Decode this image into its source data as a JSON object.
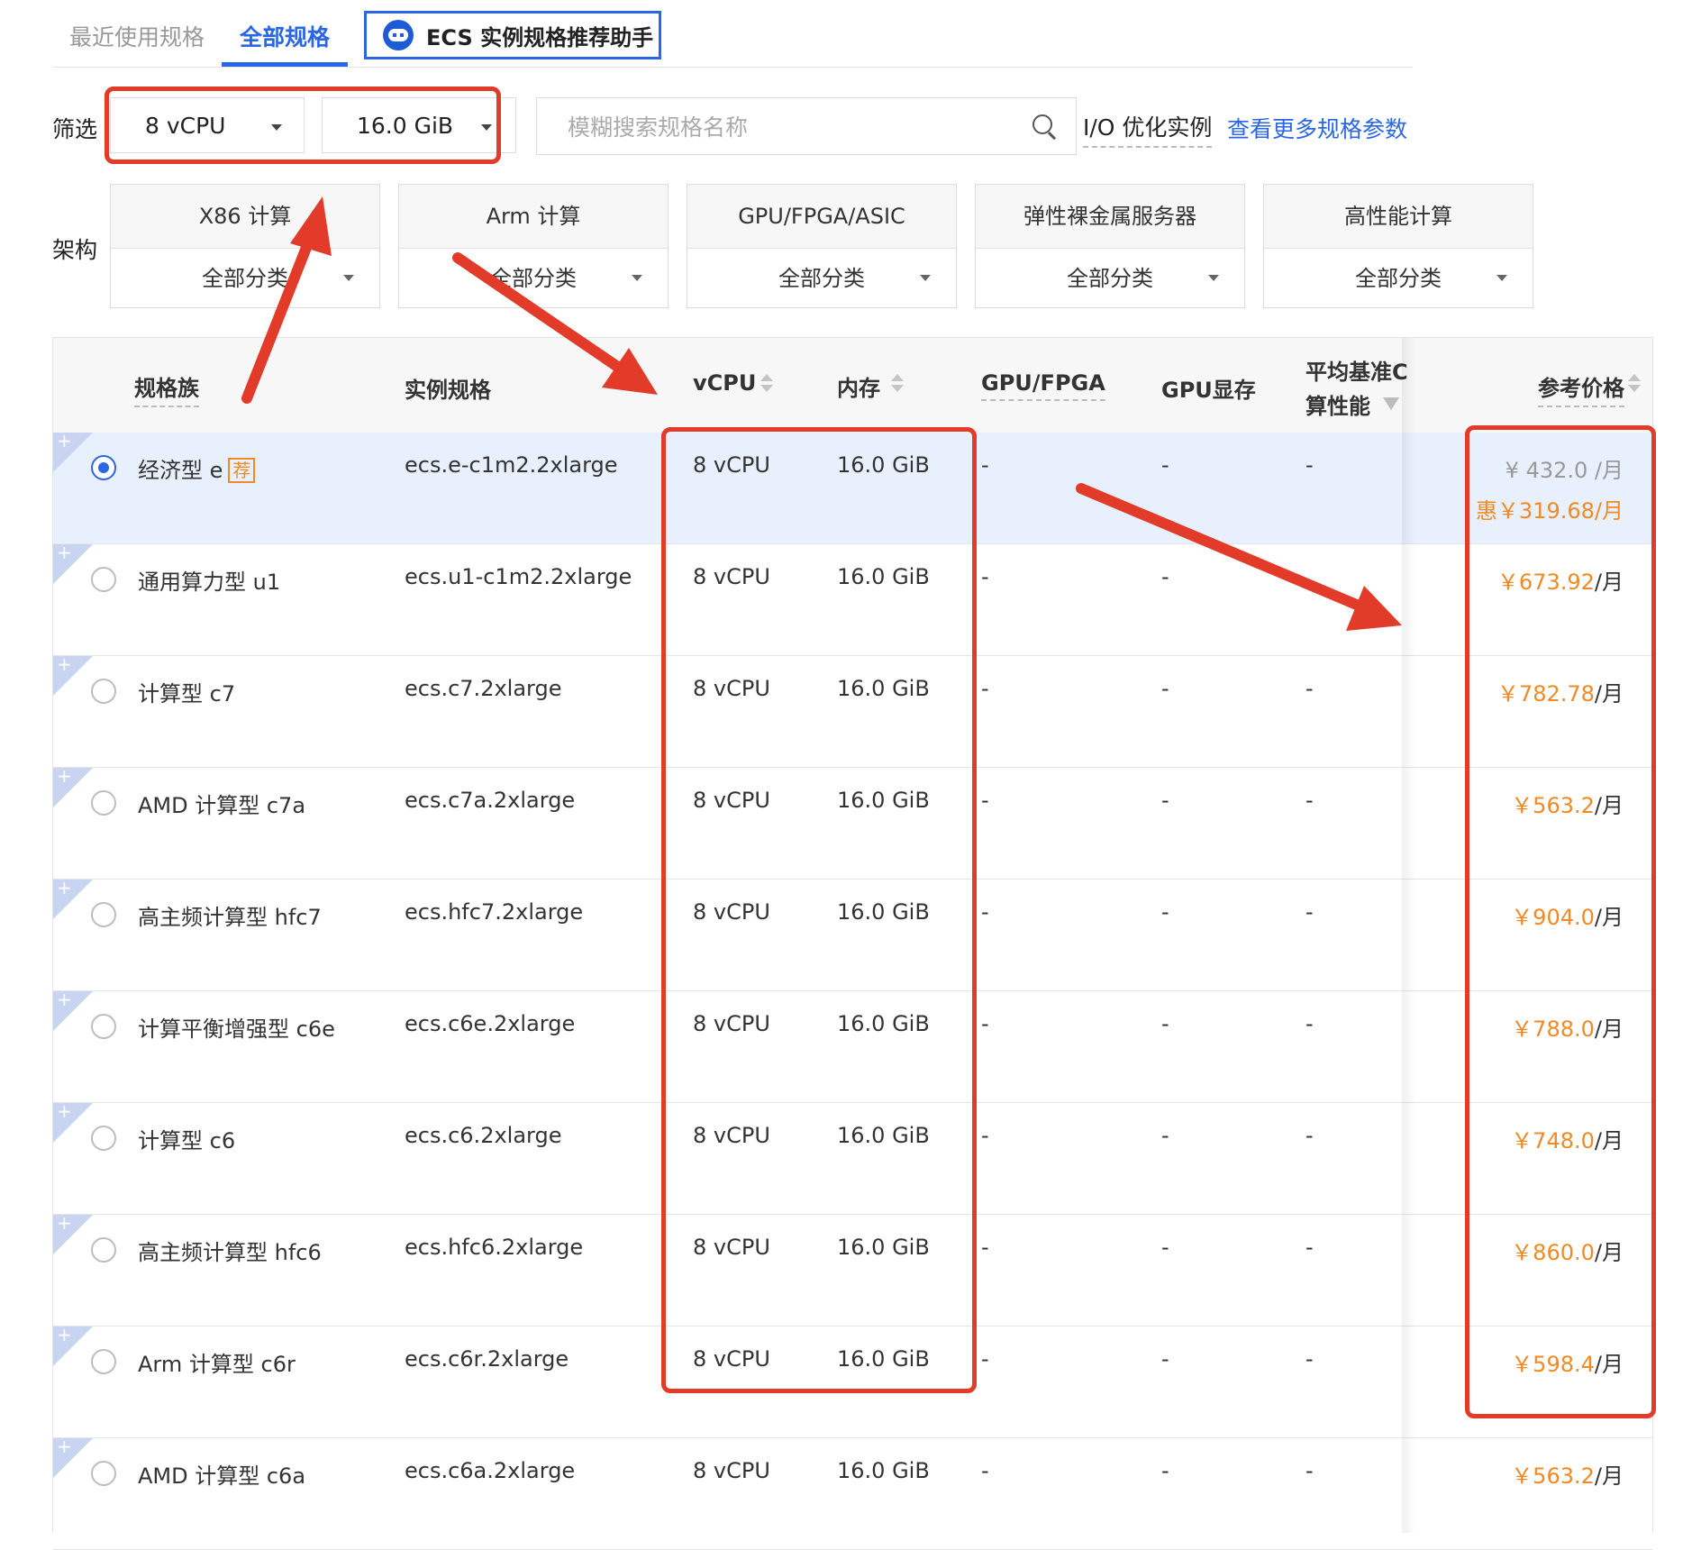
{
  "tabs": {
    "recent": "最近使用规格",
    "all": "全部规格",
    "assistant": "ECS 实例规格推荐助手"
  },
  "filter": {
    "label": "筛选",
    "vcpu_value": "8 vCPU",
    "memory_value": "16.0 GiB",
    "search_placeholder": "模糊搜索规格名称",
    "io_optimized": "I/O 优化实例",
    "more_params": "查看更多规格参数"
  },
  "architecture": {
    "label": "架构",
    "cards": [
      {
        "title": "X86 计算",
        "category": "全部分类"
      },
      {
        "title": "Arm 计算",
        "category": "全部分类"
      },
      {
        "title": "GPU/FPGA/ASIC",
        "category": "全部分类"
      },
      {
        "title": "弹性裸金属服务器",
        "category": "全部分类"
      },
      {
        "title": "高性能计算",
        "category": "全部分类"
      }
    ]
  },
  "table": {
    "headers": {
      "family": "规格族",
      "spec": "实例规格",
      "vcpu": "vCPU",
      "memory": "内存",
      "gpu": "GPU/FPGA",
      "gpu_mem": "GPU显存",
      "baseline_1": "平均基准C",
      "baseline_2": "算性能",
      "price": "参考价格"
    },
    "recommend_badge": "荐",
    "rows": [
      {
        "family": "经济型 e",
        "spec": "ecs.e-c1m2.2xlarge",
        "vcpu": "8 vCPU",
        "memory": "16.0 GiB",
        "gpu": "-",
        "gpu_mem": "-",
        "baseline": "-",
        "price_old": "¥ 432.0 /月",
        "price_discount": "惠￥319.68/月",
        "selected": true,
        "recommended": true
      },
      {
        "family": "通用算力型 u1",
        "spec": "ecs.u1-c1m2.2xlarge",
        "vcpu": "8 vCPU",
        "memory": "16.0 GiB",
        "gpu": "-",
        "gpu_mem": "-",
        "baseline": "",
        "price": "￥673.92",
        "unit": "/月"
      },
      {
        "family": "计算型 c7",
        "spec": "ecs.c7.2xlarge",
        "vcpu": "8 vCPU",
        "memory": "16.0 GiB",
        "gpu": "-",
        "gpu_mem": "-",
        "baseline": "-",
        "price": "￥782.78",
        "unit": "/月"
      },
      {
        "family": "AMD 计算型 c7a",
        "spec": "ecs.c7a.2xlarge",
        "vcpu": "8 vCPU",
        "memory": "16.0 GiB",
        "gpu": "-",
        "gpu_mem": "-",
        "baseline": "-",
        "price": "￥563.2",
        "unit": "/月"
      },
      {
        "family": "高主频计算型 hfc7",
        "spec": "ecs.hfc7.2xlarge",
        "vcpu": "8 vCPU",
        "memory": "16.0 GiB",
        "gpu": "-",
        "gpu_mem": "-",
        "baseline": "-",
        "price": "￥904.0",
        "unit": "/月"
      },
      {
        "family": "计算平衡增强型 c6e",
        "spec": "ecs.c6e.2xlarge",
        "vcpu": "8 vCPU",
        "memory": "16.0 GiB",
        "gpu": "-",
        "gpu_mem": "-",
        "baseline": "-",
        "price": "￥788.0",
        "unit": "/月"
      },
      {
        "family": "计算型 c6",
        "spec": "ecs.c6.2xlarge",
        "vcpu": "8 vCPU",
        "memory": "16.0 GiB",
        "gpu": "-",
        "gpu_mem": "-",
        "baseline": "-",
        "price": "￥748.0",
        "unit": "/月"
      },
      {
        "family": "高主频计算型 hfc6",
        "spec": "ecs.hfc6.2xlarge",
        "vcpu": "8 vCPU",
        "memory": "16.0 GiB",
        "gpu": "-",
        "gpu_mem": "-",
        "baseline": "-",
        "price": "￥860.0",
        "unit": "/月"
      },
      {
        "family": "Arm 计算型 c6r",
        "spec": "ecs.c6r.2xlarge",
        "vcpu": "8 vCPU",
        "memory": "16.0 GiB",
        "gpu": "-",
        "gpu_mem": "-",
        "baseline": "-",
        "price": "￥598.4",
        "unit": "/月"
      },
      {
        "family": "AMD 计算型 c6a",
        "spec": "ecs.c6a.2xlarge",
        "vcpu": "8 vCPU",
        "memory": "16.0 GiB",
        "gpu": "-",
        "gpu_mem": "-",
        "baseline": "-",
        "price": "￥563.2",
        "unit": "/月"
      }
    ]
  },
  "colors": {
    "primary": "#2b66e5",
    "price": "#f08a24",
    "annotation": "#e23b2a",
    "selected_row": "#e8f0fd"
  }
}
